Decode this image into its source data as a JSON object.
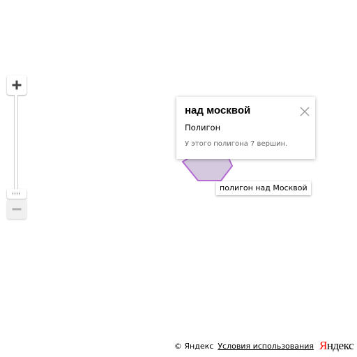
{
  "map": {
    "accent_color": "#b56ad4",
    "polygon_fill": "#cdbfd8",
    "polygon_stroke": "#b56ad4"
  },
  "zoom_control": {
    "zoom_in_icon": "plus-icon",
    "zoom_out_icon": "minus-icon",
    "handle_icon": "grip-dots-icon",
    "level_fraction": 0.0
  },
  "polygon": {
    "vertex_count": 7
  },
  "balloon": {
    "title": "над москвой",
    "body": "Полигон",
    "footer": "У этого полигона 7 вершин.",
    "close_icon": "close-icon"
  },
  "hint": {
    "text": "полигон над Москвой"
  },
  "copyrights": {
    "copyright": "© Яндекс",
    "terms_link": "Условия использования",
    "logo_first": "Я",
    "logo_rest": "ндекс"
  }
}
